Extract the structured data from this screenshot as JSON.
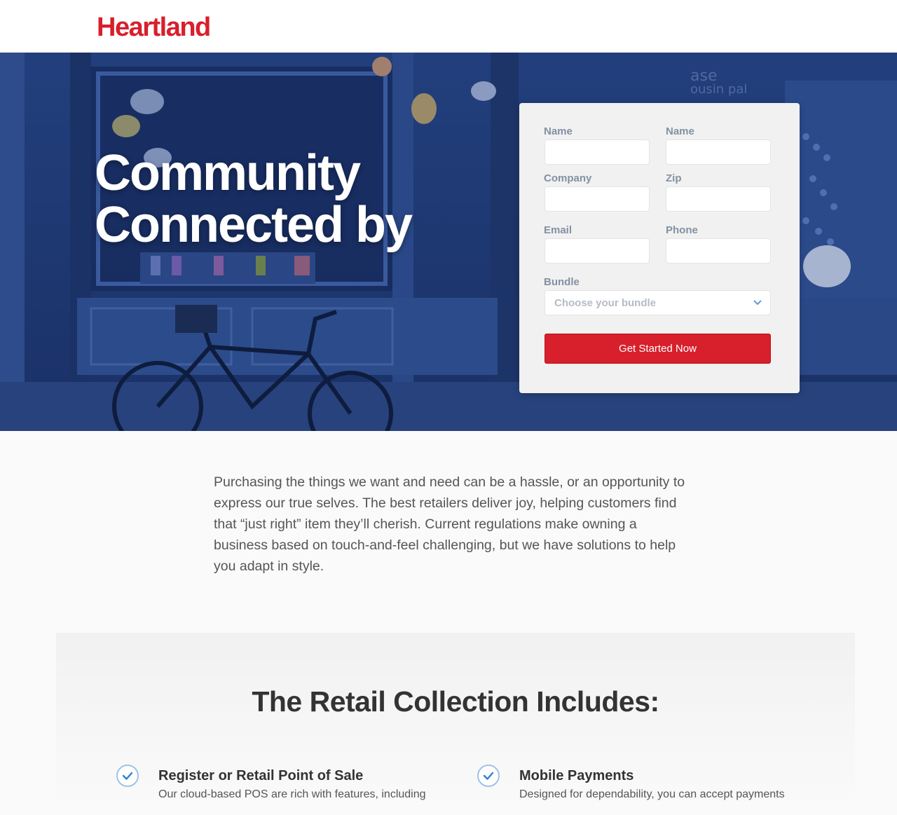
{
  "brand": {
    "logo_text": "Heartland",
    "accent": "#d81f2c",
    "hero_overlay": "#1f3a78"
  },
  "hero": {
    "title_line1": "Community",
    "title_line2": "Connected by"
  },
  "form": {
    "first_name_label": "Name",
    "last_name_label": "Name",
    "company_label": "Company",
    "zip_label": "Zip",
    "email_label": "Email",
    "phone_label": "Phone",
    "bundle_label": "Bundle",
    "bundle_placeholder": "Choose your bundle",
    "submit_label": "Get Started Now"
  },
  "intro": {
    "paragraph": "Purchasing the things we want and need can be a hassle, or an opportunity to express our true selves. The best retailers deliver joy, helping customers find that “just right” item they’ll cherish. Current regulations make owning a business based on touch-and-feel challenging, but we have solutions to help you adapt in style."
  },
  "collection": {
    "title": "The Retail Collection Includes:",
    "features": [
      {
        "title": "Register or Retail Point of Sale",
        "desc": "Our cloud-based POS are rich with features, including"
      },
      {
        "title": "Mobile Payments",
        "desc": "Designed for dependability, you can accept payments"
      }
    ]
  }
}
